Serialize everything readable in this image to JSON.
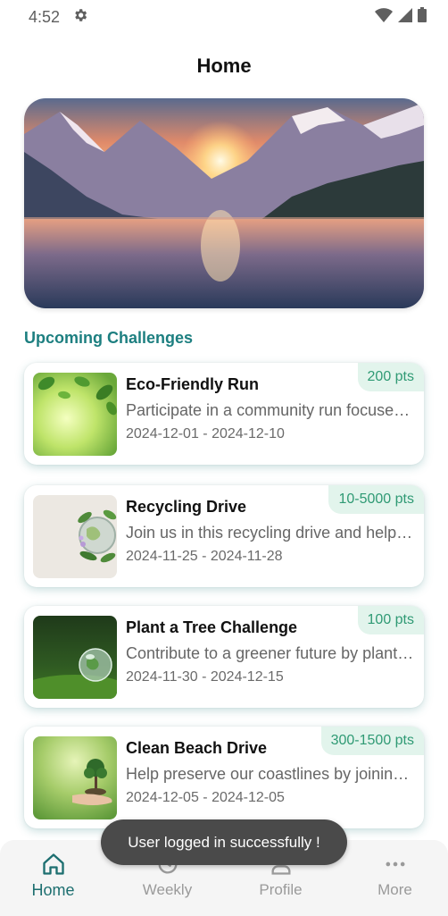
{
  "status_bar": {
    "time": "4:52",
    "icons": [
      "settings-gear-icon",
      "wifi-icon",
      "signal-icon",
      "battery-icon"
    ]
  },
  "header": {
    "title": "Home"
  },
  "hero": {
    "image": "mountain-lake-sunset-image"
  },
  "section": {
    "title": "Upcoming Challenges"
  },
  "challenges": [
    {
      "title": "Eco-Friendly Run",
      "description": "Participate in a community run focused on sustainability",
      "dates": "2024-12-01 - 2024-12-10",
      "points": "200 pts",
      "image": "green-leaves-image"
    },
    {
      "title": "Recycling Drive",
      "description": "Join us in this recycling drive and help the planet",
      "dates": "2024-11-25 - 2024-11-28",
      "points": "10-5000 pts",
      "image": "globe-with-plants-image"
    },
    {
      "title": "Plant a Tree Challenge",
      "description": "Contribute to a greener future by planting trees",
      "dates": "2024-11-30 - 2024-12-15",
      "points": "100 pts",
      "image": "glass-globe-on-moss-image"
    },
    {
      "title": "Clean Beach Drive",
      "description": "Help preserve our coastlines by joining the cleanup",
      "dates": "2024-12-05 - 2024-12-05",
      "points": "300-1500 pts",
      "image": "tree-in-hand-image"
    }
  ],
  "toast": {
    "message": "User logged in successfully !"
  },
  "nav": {
    "items": [
      {
        "label": "Home",
        "icon": "home-icon",
        "active": true
      },
      {
        "label": "Weekly",
        "icon": "history-icon",
        "active": false
      },
      {
        "label": "Profile",
        "icon": "person-icon",
        "active": false
      },
      {
        "label": "More",
        "icon": "more-dots-icon",
        "active": false
      }
    ]
  },
  "colors": {
    "accent": "#1d7f80",
    "points_bg": "#e2f4ec",
    "points_text": "#2f9a74",
    "toast_bg": "#4a4a4a"
  }
}
